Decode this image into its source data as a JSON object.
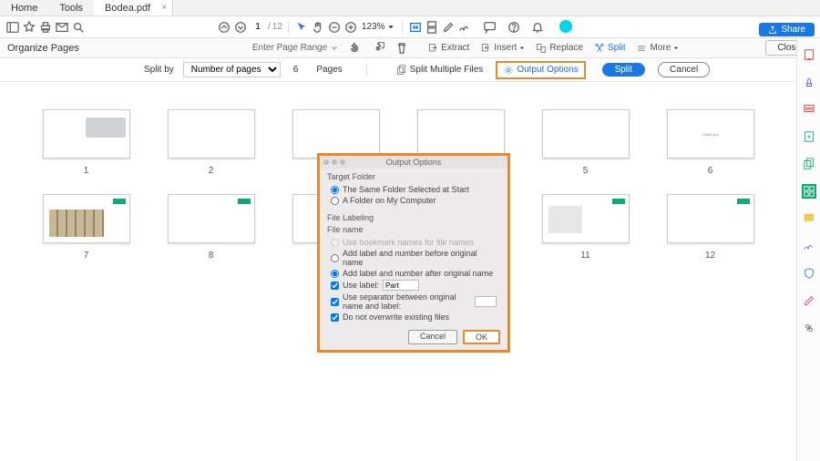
{
  "tabs": {
    "home": "Home",
    "tools": "Tools",
    "file": "Bodea.pdf"
  },
  "toolbar": {
    "page_current": "1",
    "page_total": "12",
    "zoom": "123%",
    "share": "Share"
  },
  "orgbar": {
    "title": "Organize Pages",
    "enter_range": "Enter Page Range",
    "extract": "Extract",
    "insert": "Insert",
    "replace": "Replace",
    "split": "Split",
    "more": "More",
    "close": "Close"
  },
  "split": {
    "split_by": "Split by",
    "mode": "Number of pages",
    "count": "6",
    "pages": "Pages",
    "multi": "Split Multiple Files",
    "output_options": "Output Options",
    "split_btn": "Split",
    "cancel": "Cancel"
  },
  "thumbs": {
    "page6_text": "Thank you"
  },
  "dialog": {
    "title": "Output Options",
    "target_folder": "Target Folder",
    "same_folder": "The Same Folder Selected at Start",
    "folder_on_pc": "A Folder on My Computer",
    "file_labeling": "File Labeling",
    "file_name": "File name",
    "use_bookmark": "Use bookmark names for file names",
    "add_before": "Add label and number before original name",
    "add_after": "Add label and number after original name",
    "use_label": "Use label:",
    "label_value": "Part",
    "use_separator": "Use separator between original name and label:",
    "no_overwrite": "Do not overwrite existing files",
    "cancel": "Cancel",
    "ok": "OK"
  }
}
